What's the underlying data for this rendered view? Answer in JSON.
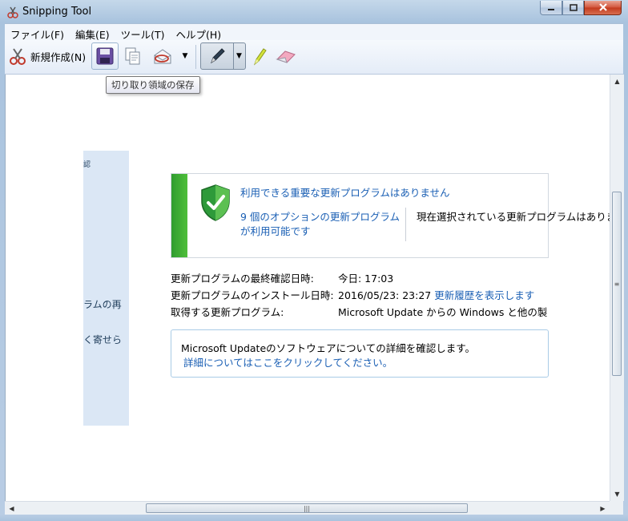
{
  "window": {
    "title": "Snipping Tool"
  },
  "menu": {
    "items": [
      "ファイル(F)",
      "編集(E)",
      "ツール(T)",
      "ヘルプ(H)"
    ]
  },
  "toolbar": {
    "new_label": "新規作成(N)",
    "tooltip": "切り取り領域の保存"
  },
  "captured": {
    "left_panel_texts": [
      "認",
      "ラムの再",
      "く寄せら"
    ],
    "status_main": "利用できる重要な更新プログラムはありません",
    "status_optional": "9 個のオプションの更新プログラムが利用可能です",
    "status_right": "現在選択されている更新プログラムはありません。",
    "info": [
      {
        "label": "更新プログラムの最終確認日時:",
        "value": "今日: 17:03",
        "link": ""
      },
      {
        "label": "更新プログラムのインストール日時:",
        "value": "2016/05/23: 23:27",
        "link": "更新履歴を表示します"
      },
      {
        "label": "取得する更新プログラム:",
        "value": "Microsoft Update からの Windows と他の製",
        "link": ""
      }
    ],
    "detail_text": "Microsoft Updateのソフトウェアについての詳細を確認します。",
    "detail_link": "詳細についてはここをクリックしてください。"
  },
  "colors": {
    "link": "#1a5fb4",
    "green_bar": "#3aa52f",
    "panel_bg": "#dbe7f5"
  }
}
